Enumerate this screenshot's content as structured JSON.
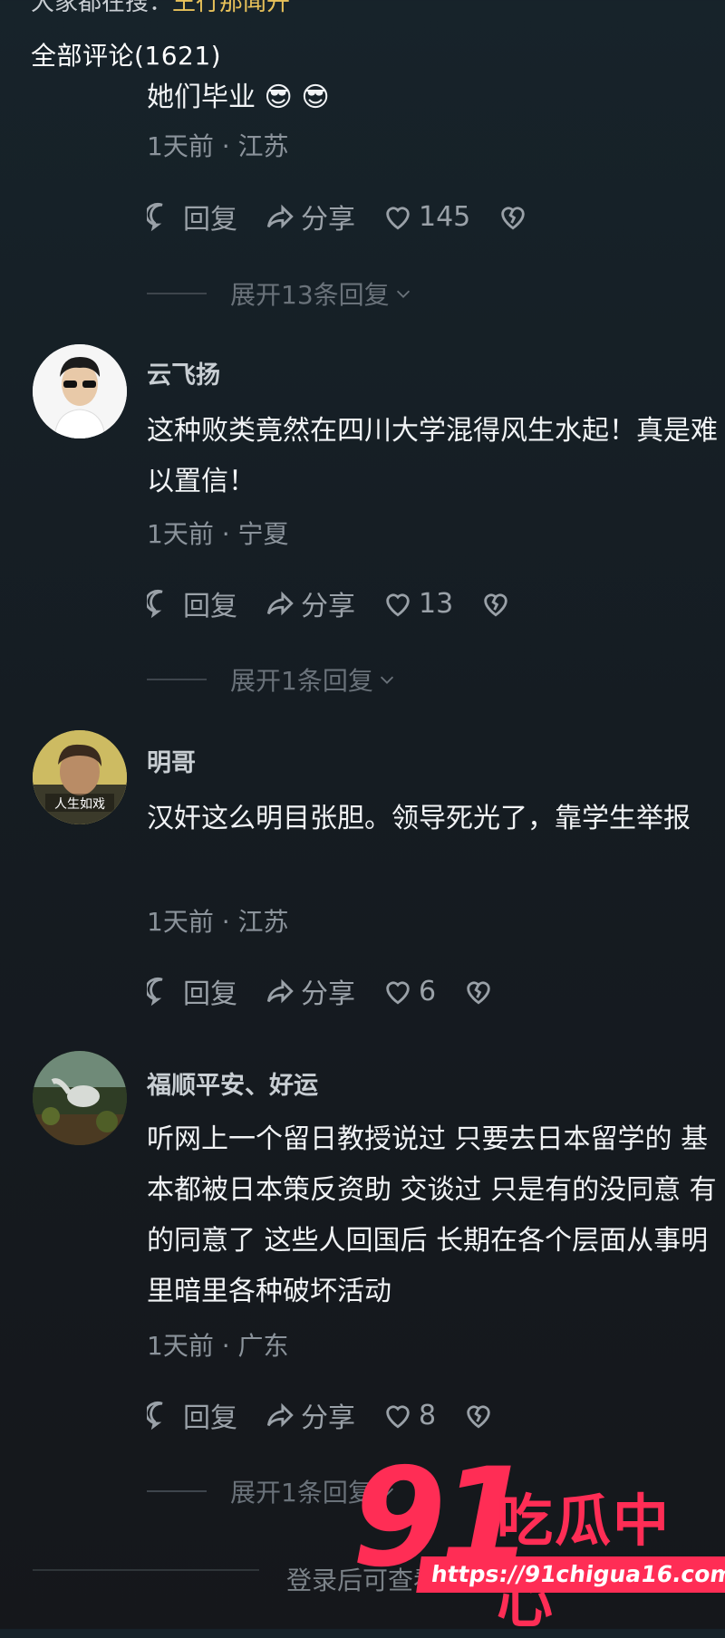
{
  "header": {
    "cut_text_plain": "大家都在搜：",
    "cut_text_highlight": "王行那闻开",
    "section_title": "全部评论(1621)"
  },
  "comments": [
    {
      "name": "",
      "text": "她们毕业 😎 😎",
      "meta": "1天前 · 江苏",
      "reply_label": "回复",
      "share_label": "分享",
      "likes": "145",
      "expand_label": "展开13条回复"
    },
    {
      "name": "云飞扬",
      "text": "这种败类竟然在四川大学混得风生水起！真是难以置信！",
      "meta": "1天前 · 宁夏",
      "reply_label": "回复",
      "share_label": "分享",
      "likes": "13",
      "expand_label": "展开1条回复"
    },
    {
      "name": "明哥",
      "avatar_text": "人生如戏",
      "text": "汉奸这么明目张胆。领导死光了，靠学生举报",
      "meta": "1天前 · 江苏",
      "reply_label": "回复",
      "share_label": "分享",
      "likes": "6"
    },
    {
      "name": "福顺平安、好运",
      "text": "听网上一个留日教授说过  只要去日本留学的 基本都被日本策反资助 交谈过 只是有的没同意 有的同意了  这些人回国后 长期在各个层面从事明里暗里各种破坏活动",
      "meta": "1天前 · 广东",
      "reply_label": "回复",
      "share_label": "分享",
      "likes": "8",
      "expand_label": "展开1条回复"
    }
  ],
  "footer": {
    "login_tip": "登录后可查看更多评论"
  },
  "watermark": {
    "number": "91",
    "name": "吃瓜中心",
    "url": "https://91chigua16.com"
  },
  "icons": [
    "reply-icon",
    "share-icon",
    "heart-icon",
    "broken-heart-icon",
    "chevron-down-icon"
  ],
  "colors": {
    "background": "#17202a",
    "watermark": "#ff2d55",
    "highlight": "#e7c15a"
  }
}
